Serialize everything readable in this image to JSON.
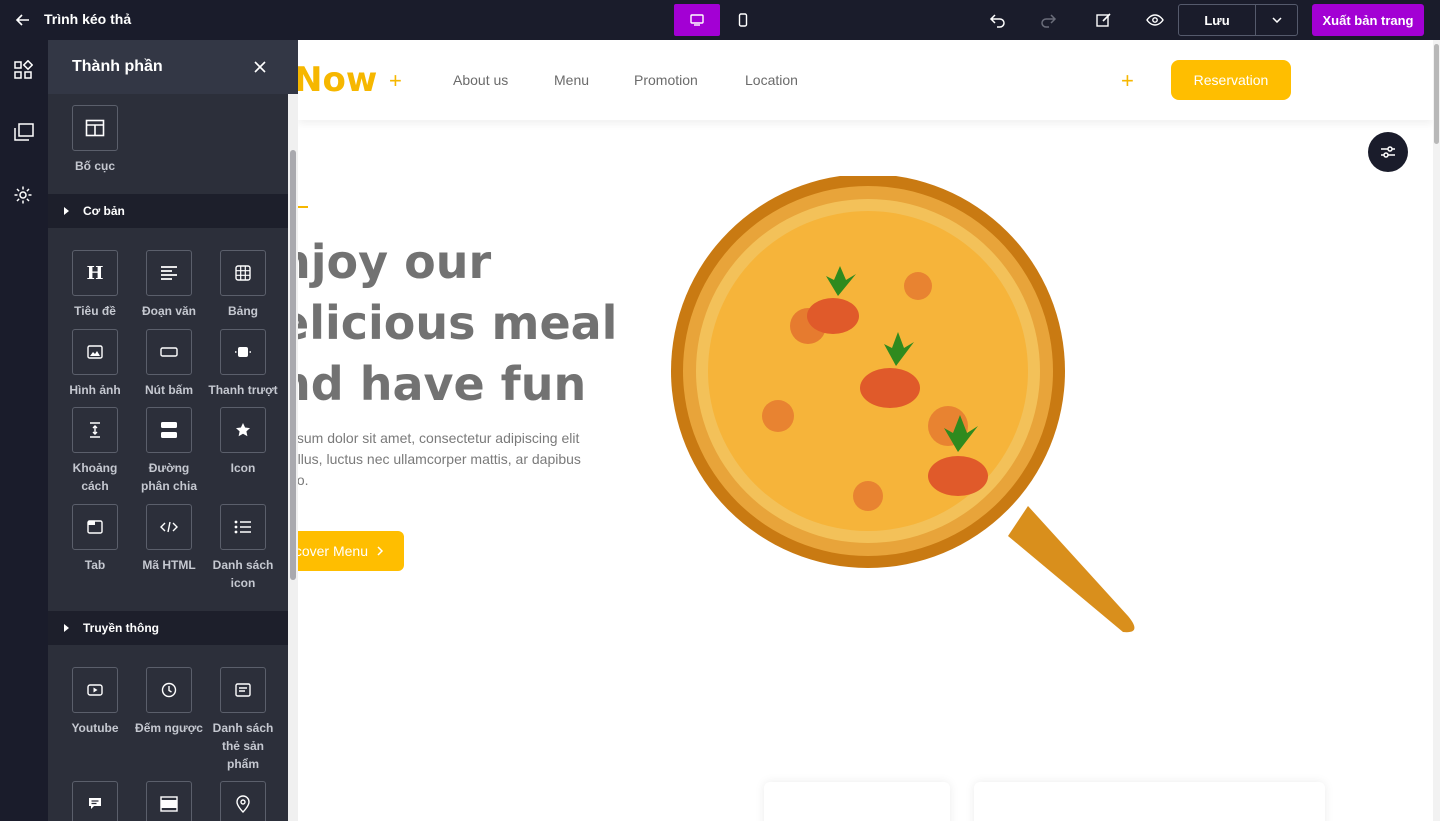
{
  "topbar": {
    "title": "Trình kéo thả",
    "save_label": "Lưu",
    "publish_label": "Xuất bản trang"
  },
  "panel": {
    "title": "Thành phần",
    "layout_label": "Bố cục",
    "sections": {
      "basic": "Cơ bản",
      "media": "Truyền thông"
    },
    "basic_items": [
      "Tiêu đề",
      "Đoạn văn",
      "Bảng",
      "Hình ảnh",
      "Nút bấm",
      "Thanh trượt",
      "Khoảng cách",
      "Đường phân chia",
      "Icon",
      "Tab",
      "Mã HTML",
      "Danh sách icon"
    ],
    "media_items": [
      "Youtube",
      "Đếm ngược",
      "Danh sách thẻ sản phẩm"
    ]
  },
  "site": {
    "logo": "Now",
    "nav": [
      "About us",
      "Menu",
      "Promotion",
      "Location"
    ],
    "reserve_label": "Reservation",
    "hero_lines": [
      "njoy our",
      "elicious meal",
      "nd have fun"
    ],
    "hero_text": "ipsum dolor sit amet, consectetur adipiscing elit tellus, luctus nec ullamcorper mattis, ar dapibus leo.",
    "menu_label": "cover Menu"
  },
  "colors": {
    "accent_purple": "#a300d4",
    "brand_yellow": "#ffbe00",
    "dark": "#1a1c2b"
  }
}
